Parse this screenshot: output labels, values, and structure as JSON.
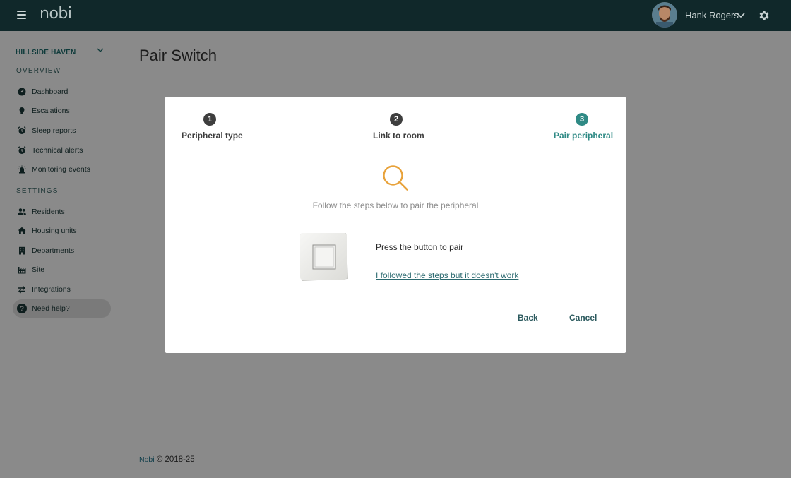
{
  "app": {
    "logo": "nobi"
  },
  "user": {
    "name": "Hank Rogers"
  },
  "sidebar": {
    "site": "HILLSIDE HAVEN",
    "overview_label": "OVERVIEW",
    "overview_items": [
      {
        "label": "Dashboard",
        "icon": "dashboard-icon"
      },
      {
        "label": "Escalations",
        "icon": "lightbulb-icon"
      },
      {
        "label": "Sleep reports",
        "icon": "alarm-clock-icon"
      },
      {
        "label": "Technical alerts",
        "icon": "alarm-clock-icon"
      },
      {
        "label": "Monitoring events",
        "icon": "alarm-light-icon"
      }
    ],
    "settings_label": "SETTINGS",
    "settings_items": [
      {
        "label": "Residents",
        "icon": "people-icon"
      },
      {
        "label": "Housing units",
        "icon": "house-icon"
      },
      {
        "label": "Departments",
        "icon": "building-icon"
      },
      {
        "label": "Site",
        "icon": "factory-icon"
      },
      {
        "label": "Integrations",
        "icon": "swap-arrows-icon"
      }
    ],
    "help": {
      "label": "Need help?",
      "icon": "question-circle-icon"
    }
  },
  "page": {
    "title": "Pair Switch"
  },
  "modal": {
    "steps": [
      {
        "number": "1",
        "label": "Peripheral type",
        "state": "done"
      },
      {
        "number": "2",
        "label": "Link to room",
        "state": "done"
      },
      {
        "number": "3",
        "label": "Pair peripheral",
        "state": "active"
      }
    ],
    "instruction": "Follow the steps below to pair the peripheral",
    "press_text": "Press the button to pair",
    "help_link": "I followed the steps but it doesn't work",
    "back_label": "Back",
    "cancel_label": "Cancel"
  },
  "footer": {
    "brand": "Nobi",
    "text": "© 2018-25"
  },
  "colors": {
    "topbar": "#10282a",
    "accent": "#2f8a85",
    "search_icon": "#e8a23a",
    "overlay": "#8a8a8a"
  }
}
